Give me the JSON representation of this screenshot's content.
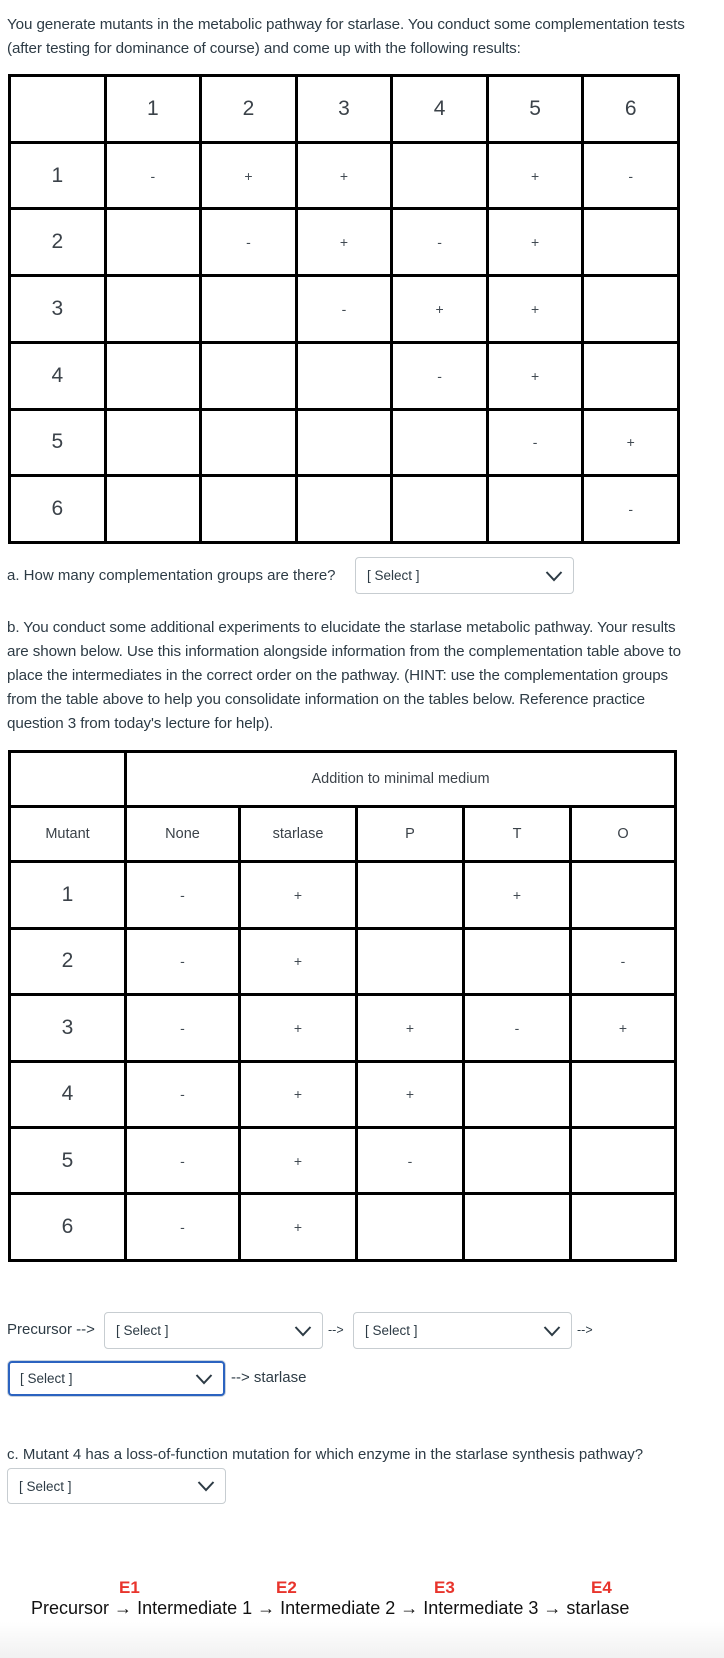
{
  "intro": "You generate mutants in the metabolic pathway for starlase. You conduct some complementation tests (after testing for dominance of course) and come up with the following results:",
  "complementation_table": {
    "column_headers": [
      "",
      "1",
      "2",
      "3",
      "4",
      "5",
      "6"
    ],
    "rows": [
      {
        "label": "1",
        "cells": [
          "-",
          "+",
          "+",
          "",
          "+",
          "-"
        ]
      },
      {
        "label": "2",
        "cells": [
          "",
          "-",
          "+",
          "-",
          "+",
          ""
        ]
      },
      {
        "label": "3",
        "cells": [
          "",
          "",
          "-",
          "+",
          "+",
          ""
        ]
      },
      {
        "label": "4",
        "cells": [
          "",
          "",
          "",
          "-",
          "+",
          ""
        ]
      },
      {
        "label": "5",
        "cells": [
          "",
          "",
          "",
          "",
          "-",
          "+"
        ]
      },
      {
        "label": "6",
        "cells": [
          "",
          "",
          "",
          "",
          "",
          "-"
        ]
      }
    ]
  },
  "question_a": {
    "text": "a. How many complementation groups are there?",
    "select_value": "[ Select ]"
  },
  "question_b": {
    "text": "b. You conduct some additional experiments to elucidate the starlase metabolic pathway. Your results are shown below. Use this information alongside information from the complementation table above to place the intermediates in the correct order on the pathway. (HINT: use the complementation groups from the table above to help you consolidate information on the tables below. Reference practice question 3 from today's lecture for help)."
  },
  "growth_table": {
    "super_header": "Addition to minimal medium",
    "column_headers": [
      "Mutant",
      "None",
      "starlase",
      "P",
      "T",
      "O"
    ],
    "rows": [
      {
        "label": "1",
        "cells": [
          "-",
          "+",
          "",
          "+",
          ""
        ]
      },
      {
        "label": "2",
        "cells": [
          "-",
          "+",
          "",
          "",
          "-"
        ]
      },
      {
        "label": "3",
        "cells": [
          "-",
          "+",
          "+",
          "-",
          "+"
        ]
      },
      {
        "label": "4",
        "cells": [
          "-",
          "+",
          "+",
          "",
          ""
        ]
      },
      {
        "label": "5",
        "cells": [
          "-",
          "+",
          "-",
          "",
          ""
        ]
      },
      {
        "label": "6",
        "cells": [
          "-",
          "+",
          "",
          "",
          ""
        ]
      }
    ]
  },
  "pathway_answer": {
    "precursor_label": "Precursor -->",
    "arrow": "-->",
    "end_label": "--> starlase",
    "select_1": "[ Select ]",
    "select_2": "[ Select ]",
    "select_3": "[ Select ]"
  },
  "question_c": {
    "text": "c. Mutant 4 has a loss-of-function mutation for which enzyme in the starlase synthesis pathway?",
    "select_value": "[ Select ]"
  },
  "pathway_diagram": {
    "enzymes": [
      "E1",
      "E2",
      "E3",
      "E4"
    ],
    "steps": [
      "Precursor",
      "Intermediate 1",
      "Intermediate 2",
      "Intermediate 3",
      "starlase"
    ],
    "arrow_glyph": "→",
    "enzyme_color": "#e8342c"
  }
}
